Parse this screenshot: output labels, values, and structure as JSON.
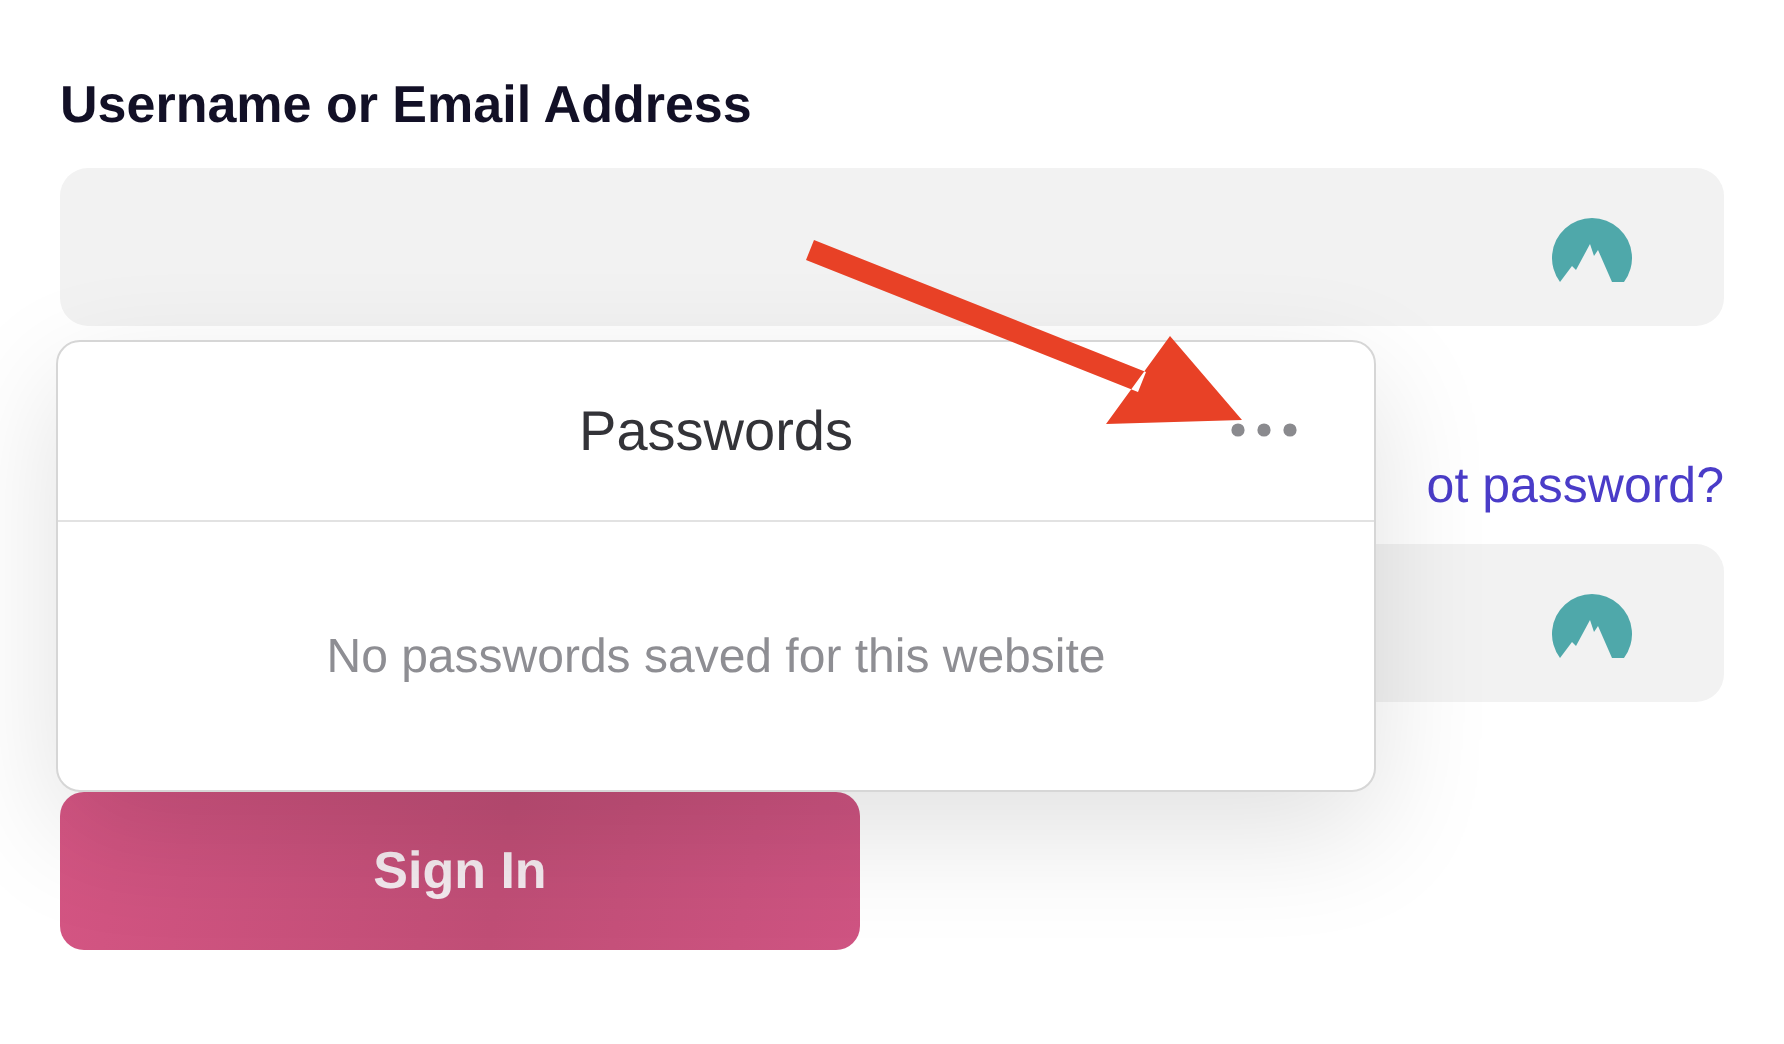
{
  "form": {
    "username_label": "Username or Email Address",
    "forgot_link": "ot password?",
    "submit_button": "Sign In"
  },
  "popup": {
    "title": "Passwords",
    "empty_message": "No passwords saved for this website"
  }
}
